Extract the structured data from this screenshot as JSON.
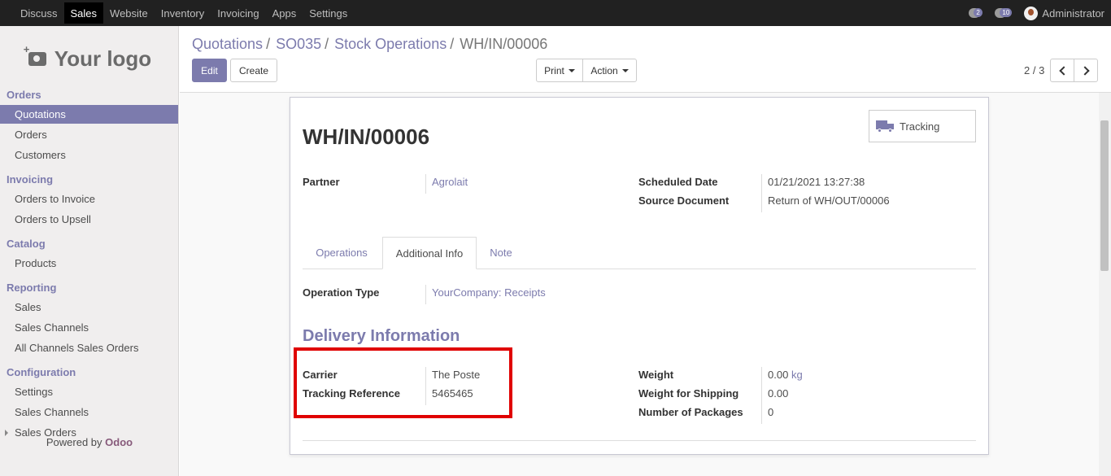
{
  "topbar": {
    "menu": [
      "Discuss",
      "Sales",
      "Website",
      "Inventory",
      "Invoicing",
      "Apps",
      "Settings"
    ],
    "active_menu": "Sales",
    "activity_count": "2",
    "message_count": "10",
    "user": "Administrator"
  },
  "sidebar": {
    "logo": "Your logo",
    "sections": [
      {
        "title": "Orders",
        "items": [
          "Quotations",
          "Orders",
          "Customers"
        ]
      },
      {
        "title": "Invoicing",
        "items": [
          "Orders to Invoice",
          "Orders to Upsell"
        ]
      },
      {
        "title": "Catalog",
        "items": [
          "Products"
        ]
      },
      {
        "title": "Reporting",
        "items": [
          "Sales",
          "Sales Channels",
          "All Channels Sales Orders"
        ]
      },
      {
        "title": "Configuration",
        "items": [
          "Settings",
          "Sales Channels",
          "Sales Orders"
        ]
      }
    ],
    "active_item": "Quotations",
    "powered_prefix": "Powered by",
    "powered_brand": "Odoo"
  },
  "breadcrumb": {
    "items": [
      "Quotations",
      "SO035",
      "Stock Operations"
    ],
    "current": "WH/IN/00006"
  },
  "toolbar": {
    "edit": "Edit",
    "create": "Create",
    "print": "Print",
    "action": "Action",
    "pager": "2 / 3"
  },
  "form": {
    "tracking_button": "Tracking",
    "title": "WH/IN/00006",
    "partner_label": "Partner",
    "partner_value": "Agrolait",
    "scheduled_date_label": "Scheduled Date",
    "scheduled_date_value": "01/21/2021 13:27:38",
    "source_document_label": "Source Document",
    "source_document_value": "Return of WH/OUT/00006",
    "tabs": [
      "Operations",
      "Additional Info",
      "Note"
    ],
    "active_tab": "Additional Info",
    "operation_type_label": "Operation Type",
    "operation_type_value": "YourCompany: Receipts",
    "delivery_title": "Delivery Information",
    "carrier_label": "Carrier",
    "carrier_value": "The Poste",
    "tracking_ref_label": "Tracking Reference",
    "tracking_ref_value": "5465465",
    "weight_label": "Weight",
    "weight_value": "0.00",
    "weight_unit": "kg",
    "shipping_weight_label": "Weight for Shipping",
    "shipping_weight_value": "0.00",
    "packages_label": "Number of Packages",
    "packages_value": "0"
  },
  "colors": {
    "accent": "#7c7bad",
    "topbar": "#212121",
    "highlight": "#e00000"
  }
}
